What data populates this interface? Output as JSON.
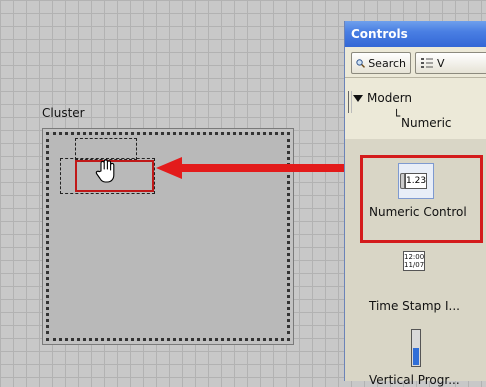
{
  "cluster": {
    "label": "Cluster"
  },
  "palette": {
    "title": "Controls",
    "toolbar": {
      "search_label": "Search",
      "view_label": "V"
    },
    "tree": {
      "root": "Modern",
      "child": "Numeric"
    },
    "items": [
      {
        "label": "Numeric Control",
        "icon_text": "1.23",
        "selected": true
      },
      {
        "label": "Time Stamp I...",
        "icon_text_line1": "12:00",
        "icon_text_line2": "11/07"
      },
      {
        "label": "Vertical Progr...",
        "level": 0.5
      }
    ]
  },
  "colors": {
    "highlight": "#d41c1c",
    "title_bar": "#3a6fd8",
    "progress_fill": "#2f6ed8"
  }
}
